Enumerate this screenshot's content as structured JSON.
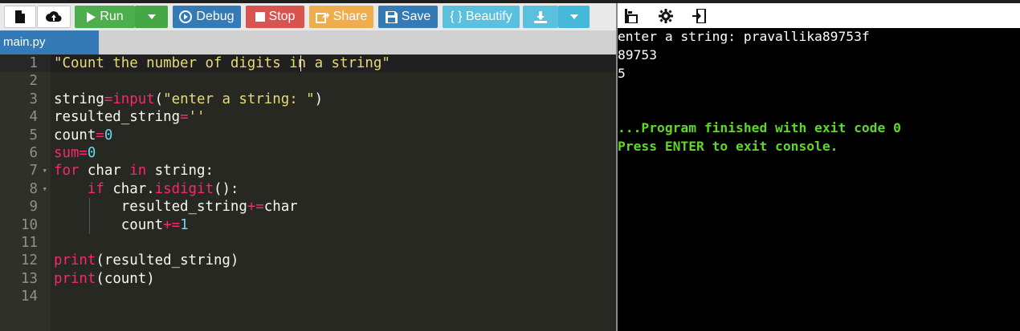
{
  "toolbar": {
    "run_label": "Run",
    "debug_label": "Debug",
    "stop_label": "Stop",
    "share_label": "Share",
    "save_label": "Save",
    "beautify_label": "{ } Beautify"
  },
  "editor": {
    "tab_label": "main.py",
    "line_numbers": [
      "1",
      "2",
      "3",
      "4",
      "5",
      "6",
      "7",
      "8",
      "9",
      "10",
      "11",
      "12",
      "13",
      "14"
    ]
  },
  "console": {
    "lines": [
      "enter a string: pravallika89753f",
      "89753",
      "5",
      "",
      "",
      "...Program finished with exit code 0",
      "Press ENTER to exit console."
    ]
  },
  "icons": {
    "new_file": "file-icon",
    "upload": "upload-icon",
    "run": "play-icon",
    "debug": "debug-icon",
    "stop": "stop-icon",
    "share": "share-icon",
    "save": "save-icon",
    "download": "download-icon",
    "dropdown": "chevron-down-icon",
    "console_layout": "layout-icon",
    "settings": "gear-icon",
    "exit": "exit-icon"
  },
  "colors": {
    "run": "#4cae4c",
    "debug": "#337ab7",
    "stop": "#d9534f",
    "share": "#f0ad4e",
    "save": "#337ab7",
    "beautify": "#5bc0de",
    "editor_bg": "#272822",
    "console_finish": "#5fd729"
  }
}
